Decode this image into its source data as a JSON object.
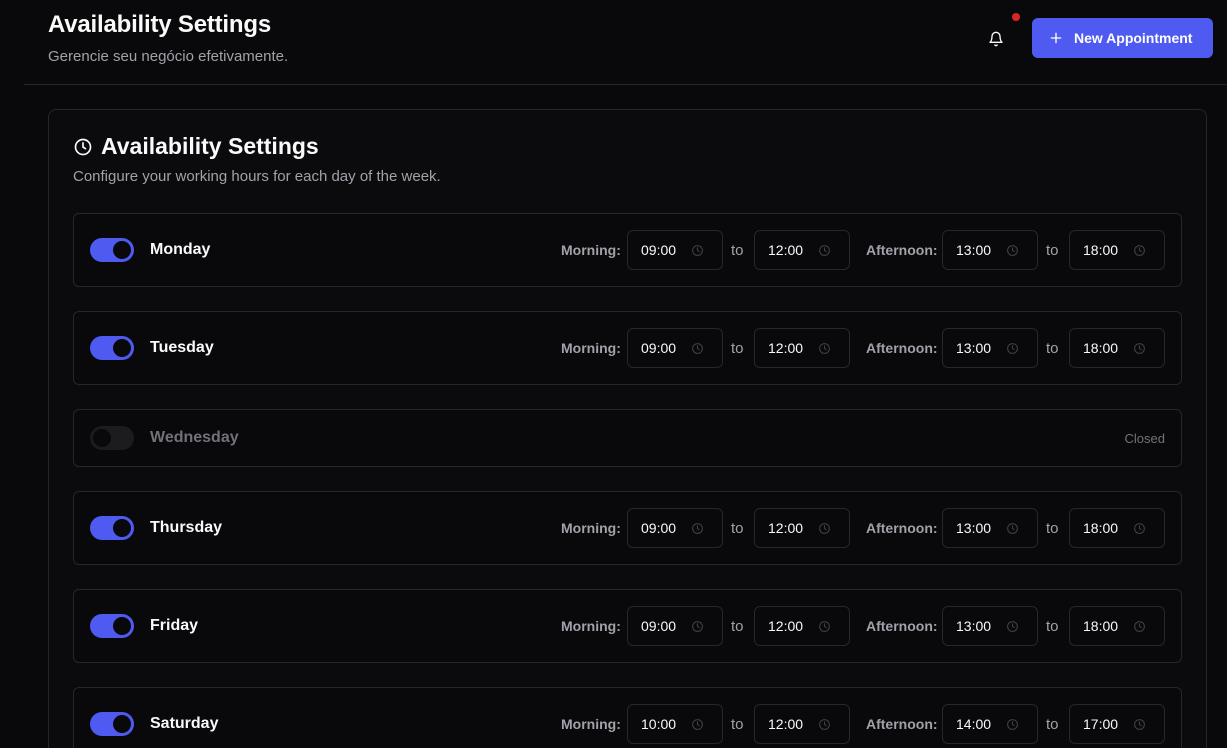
{
  "header": {
    "title": "Availability Settings",
    "subtitle": "Gerencie seu negócio efetivamente.",
    "new_appointment_label": "New Appointment"
  },
  "card": {
    "title": "Availability Settings",
    "subtitle": "Configure your working hours for each day of the week."
  },
  "labels": {
    "morning": "Morning:",
    "afternoon": "Afternoon:",
    "to": "to",
    "closed": "Closed"
  },
  "days": [
    {
      "name": "Monday",
      "enabled": true,
      "morning_start": "09:00",
      "morning_end": "12:00",
      "afternoon_start": "13:00",
      "afternoon_end": "18:00"
    },
    {
      "name": "Tuesday",
      "enabled": true,
      "morning_start": "09:00",
      "morning_end": "12:00",
      "afternoon_start": "13:00",
      "afternoon_end": "18:00"
    },
    {
      "name": "Wednesday",
      "enabled": false
    },
    {
      "name": "Thursday",
      "enabled": true,
      "morning_start": "09:00",
      "morning_end": "12:00",
      "afternoon_start": "13:00",
      "afternoon_end": "18:00"
    },
    {
      "name": "Friday",
      "enabled": true,
      "morning_start": "09:00",
      "morning_end": "12:00",
      "afternoon_start": "13:00",
      "afternoon_end": "18:00"
    },
    {
      "name": "Saturday",
      "enabled": true,
      "morning_start": "10:00",
      "morning_end": "12:00",
      "afternoon_start": "14:00",
      "afternoon_end": "17:00"
    }
  ],
  "colors": {
    "accent": "#4f5bf0",
    "background": "#09090b",
    "border": "#27272a",
    "muted_text": "#a1a1aa",
    "notification_dot": "#dc2626"
  },
  "icons": {
    "bell": "bell-icon",
    "plus": "plus-icon",
    "clock": "clock-icon",
    "input_clock": "clock-icon"
  }
}
